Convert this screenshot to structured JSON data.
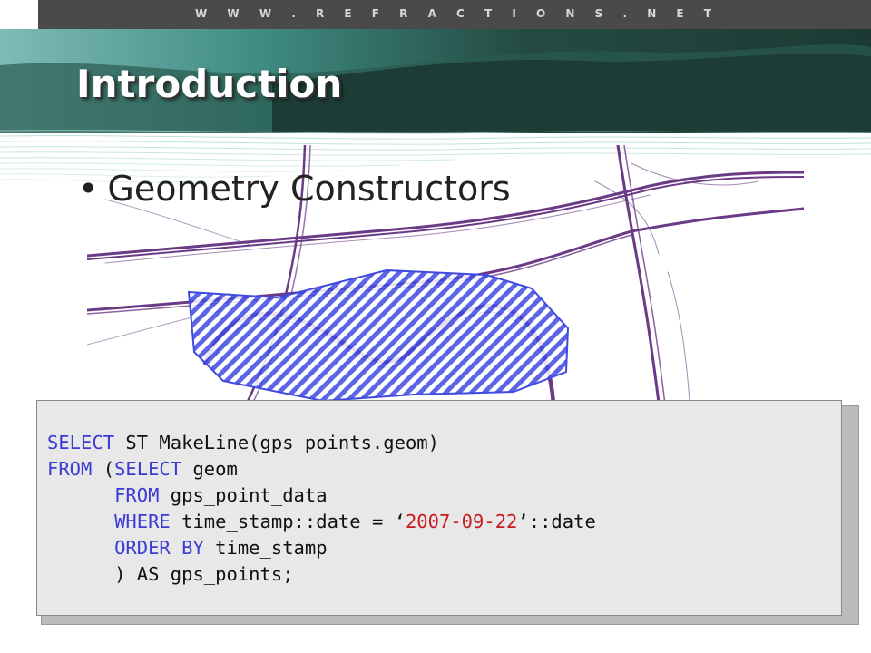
{
  "header": {
    "site_url": "W W W . R E F R A C T I O N S . N E T"
  },
  "slide": {
    "title": "Introduction",
    "bullets": [
      {
        "text": "Geometry Constructors"
      }
    ]
  },
  "code": {
    "line1": {
      "kw1": "SELECT",
      "t1": " ST_MakeLine(gps_points.geom)"
    },
    "line2": {
      "kw1": "FROM",
      "t1": " (",
      "kw2": "SELECT",
      "t2": " geom"
    },
    "line3": {
      "indent": "      ",
      "kw1": "FROM",
      "t1": " gps_point_data"
    },
    "line4": {
      "indent": "      ",
      "kw1": "WHERE",
      "t1": " time_stamp::date = ",
      "q1": "‘",
      "str": "2007-09-22",
      "q2": "’",
      "t2": "::date"
    },
    "line5": {
      "indent": "      ",
      "kw1": "ORDER BY",
      "t1": " time_stamp"
    },
    "line6": {
      "indent": "      ",
      "t1": ") AS gps_points;"
    }
  },
  "colors": {
    "road": "#6a3a86",
    "hatch": "#3e4ae0",
    "keyword": "#3a3ad4",
    "string": "#c8191e",
    "banner_dark": "#1e3a33",
    "banner_teal": "#2f8a80"
  }
}
